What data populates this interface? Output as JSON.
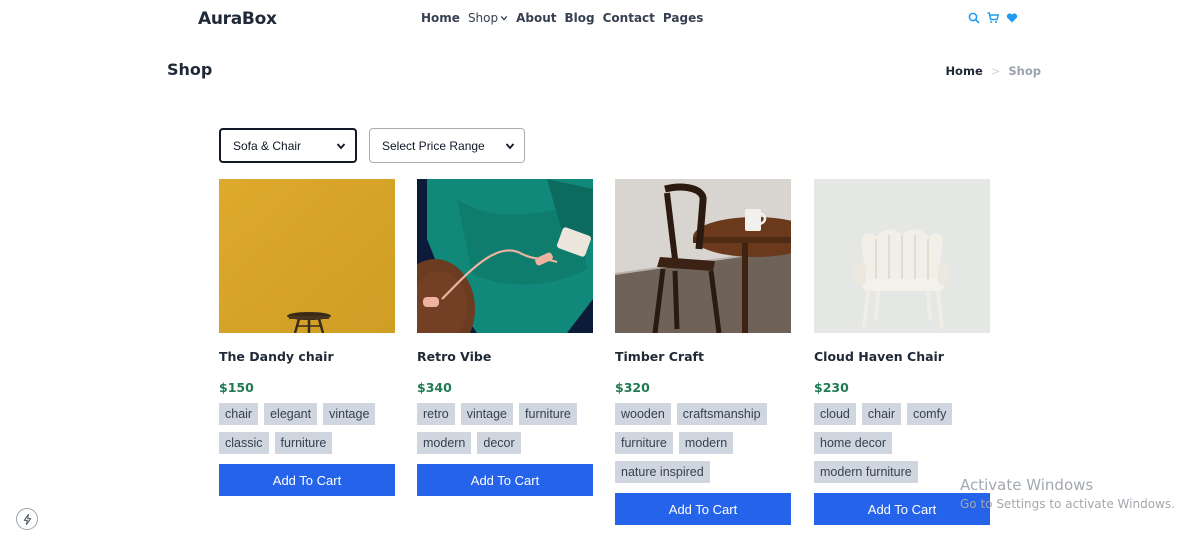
{
  "brand": {
    "name": "AuraBox"
  },
  "nav": {
    "links": [
      "Home",
      "Shop",
      "About",
      "Blog",
      "Contact",
      "Pages"
    ],
    "icons": [
      "search-icon",
      "cart-icon",
      "heart-icon"
    ],
    "accent_color": "#1e9bf0"
  },
  "page": {
    "title": "Shop",
    "breadcrumb": {
      "home": "Home",
      "separator": ">",
      "current": "Shop"
    }
  },
  "filters": {
    "category": {
      "selected": "Sofa & Chair"
    },
    "price": {
      "selected": "Select Price Range"
    }
  },
  "products": [
    {
      "name": "The Dandy chair",
      "price": "$150",
      "tags": [
        "chair",
        "elegant",
        "vintage",
        "classic",
        "furniture"
      ],
      "cta": "Add To Cart"
    },
    {
      "name": "Retro Vibe",
      "price": "$340",
      "tags": [
        "retro",
        "vintage",
        "furniture",
        "modern",
        "decor"
      ],
      "cta": "Add To Cart"
    },
    {
      "name": "Timber Craft",
      "price": "$320",
      "tags": [
        "wooden",
        "craftsmanship",
        "furniture",
        "modern",
        "nature inspired"
      ],
      "cta": "Add To Cart"
    },
    {
      "name": "Cloud Haven Chair",
      "price": "$230",
      "tags": [
        "cloud",
        "chair",
        "comfy",
        "home decor",
        "modern furniture"
      ],
      "cta": "Add To Cart"
    }
  ],
  "colors": {
    "price": "#1f7a53",
    "button": "#2563eb",
    "tag_bg": "#cfd6e0"
  },
  "watermark": {
    "title": "Activate Windows",
    "subtitle": "Go to Settings to activate Windows."
  }
}
